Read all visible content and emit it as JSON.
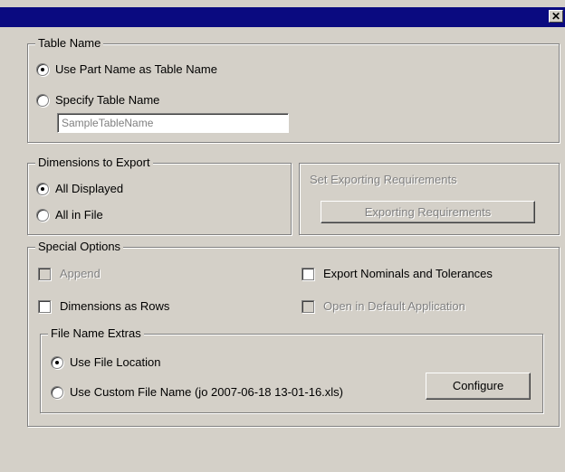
{
  "window": {
    "title": "",
    "close_glyph": "✕"
  },
  "table_name": {
    "legend": "Table Name",
    "use_part_name": "Use Part Name as Table Name",
    "specify_name": "Specify Table Name",
    "name_value": "SampleTableName",
    "selected": "use_part_name"
  },
  "dimensions_export": {
    "legend": "Dimensions to Export",
    "all_displayed": "All Displayed",
    "all_in_file": "All in File",
    "selected": "all_displayed"
  },
  "exporting_requirements": {
    "label": "Set Exporting Requirements",
    "button": "Exporting Requirements",
    "enabled": false
  },
  "special_options": {
    "legend": "Special Options",
    "append": "Append",
    "export_nominals": "Export Nominals and Tolerances",
    "dimensions_as_rows": "Dimensions as Rows",
    "open_default_app": "Open in Default Application"
  },
  "file_name_extras": {
    "legend": "File Name Extras",
    "use_file_location": "Use File Location",
    "use_custom_name": "Use Custom File Name  (jo 2007-06-18 13-01-16.xls)",
    "configure_button": "Configure",
    "selected": "use_file_location"
  }
}
